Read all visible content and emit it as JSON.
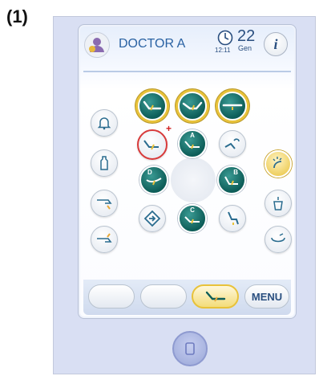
{
  "figure_label": "(1)",
  "header": {
    "doctor_name": "DOCTOR A",
    "time": "12:11",
    "day": "22",
    "month": "Gen",
    "info_symbol": "i"
  },
  "positions": {
    "memory_a": "A",
    "memory_b": "B",
    "memory_c": "C",
    "memory_d": "D"
  },
  "bottom_bar": {
    "menu_label": "MENU"
  },
  "icons": {
    "left_column": [
      "bell-icon",
      "water-bottle-icon",
      "tool-hand-down-icon",
      "tool-hand-up-icon"
    ],
    "right_column": [
      "spray-hands-icon",
      "cup-filler-icon",
      "bowl-rinse-icon"
    ],
    "top_row": [
      "chair-recline-icon",
      "chair-trendelenburg-icon",
      "chair-flat-icon"
    ]
  },
  "colors": {
    "accent_teal": "#0d5d58",
    "highlight_gold": "#e8c23a",
    "text_blue": "#2a62a3",
    "alert_red": "#d02020"
  }
}
